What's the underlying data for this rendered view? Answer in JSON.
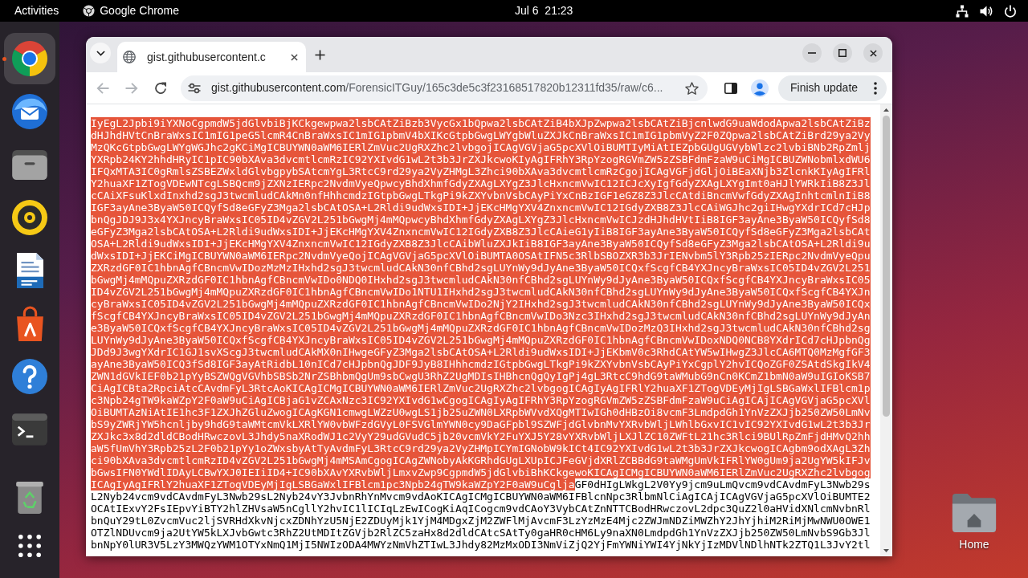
{
  "top_bar": {
    "activities": "Activities",
    "app_menu": "Google Chrome",
    "clock": "Jul 6  21:23"
  },
  "dock": {
    "items": [
      {
        "kind": "browser",
        "running": true,
        "selected": true
      },
      {
        "kind": "mail",
        "running": false,
        "selected": false
      },
      {
        "kind": "files",
        "running": false,
        "selected": false
      },
      {
        "kind": "music",
        "running": false,
        "selected": false
      },
      {
        "kind": "writer",
        "running": false,
        "selected": false
      },
      {
        "kind": "store",
        "running": false,
        "selected": false
      },
      {
        "kind": "help",
        "running": false,
        "selected": false
      },
      {
        "kind": "terminal",
        "running": false,
        "selected": false
      },
      {
        "kind": "trash",
        "running": false,
        "selected": false
      },
      {
        "kind": "apps",
        "running": false,
        "selected": false
      }
    ]
  },
  "desktop": {
    "icons": [
      {
        "label": "Home"
      }
    ]
  },
  "browser": {
    "tabs": [
      {
        "title": "gist.githubusercontent.c",
        "selected": true
      }
    ],
    "back": {
      "disabled": true
    },
    "forward": {
      "disabled": true
    },
    "address_bar": {
      "host": "gist.githubusercontent.com",
      "path": "/ForensicITGuy/165c3de5c3f23168517820b12311fd35/raw/c6..."
    },
    "update_button": "Finish update",
    "page": {
      "lines": [
        {
          "segments": [
            {
              "text": "IyEgL2Jpbi9iYXNoCgpmdW5jdGlvbiBjKCkgewpwa2lsbCAtZiBzb3VycGx1bQpwa2lsbCAtZiB4bXJpZwpwa2lsbCAtZiBjcnlwdG9uaWdodApwa2lsbCAtZiBz",
              "selected": true
            }
          ]
        },
        {
          "segments": [
            {
              "text": "dHJhdHVtCnBraWxsIC1mIG1peG5lcmR4CnBraWxsIC1mIG1pbmV4bXIKcGtpbGwgLWYgbWluZXJkCnBraWxsIC1mIG1pbmVyZ2F0ZQpwa2lsbCAtZiBrd29ya2Vy",
              "selected": true
            }
          ]
        },
        {
          "segments": [
            {
              "text": "MzQKcGtpbGwgLWYgWGJhc2gKCiMgICBUYWN0aWM6IERlZmVuc2UgRXZhc2lvbgojICAgVGVjaG5pcXVlOiBUMTIyMiAtIEZpbGUgUGVybWlzc2lvbiBNb2RpZmlj",
              "selected": true
            }
          ]
        },
        {
          "segments": [
            {
              "text": "YXRpb24KY2hhdHRyIC1pIC90bXAva3dvcmtlcmRzIC92YXIvdG1wL2t3b3JrZXJkcwoKIyAgIFRhY3RpYzogRGVmZW5zZSBFdmFzaW9uCiMgICBUZWNobmlxdWU6",
              "selected": true
            }
          ]
        },
        {
          "segments": [
            {
              "text": "IFQxMTA3IC0gRmlsZSBEZWxldGlvbgpybSAtcmYgL3RtcC9rd29ya2VyZHMgL3Zhci90bXAva3dvcmtlcmRzCgojICAgVGFjdGljOiBEaXNjb3ZlcnkKIyAgIFRl",
              "selected": true
            }
          ]
        },
        {
          "segments": [
            {
              "text": "Y2huaXF1ZTogVDEwNTcgLSBQcm9jZXNzIERpc2NvdmVyeQpwcyBhdXhmfGdyZXAgLXYgZ3JlcHxncmVwIC12ICJcXyIgfGdyZXAgLXYgImt0aHJlYWRkIiB8Z3Jl",
              "selected": true
            }
          ]
        },
        {
          "segments": [
            {
              "text": "cCAiXFsuKlxdInxhd2sgJ3twcmludCAkMn0nfHhhcmdzIGtpbGwgLTkgPi9kZXYvbnVsbCAyPiYxCnBzIGF1eGZ8Z3JlcCAtdiBncmVwfGdyZXAgInhtcmlnIiB8",
              "selected": true
            }
          ]
        },
        {
          "segments": [
            {
              "text": "IGF3ayAne3ByaW50ICQyfSd8eGFyZ3Mga2lsbCAtOSA+L2Rldi9udWxsIDI+JjEKcHMgYXV4ZnxncmVwIC12IGdyZXB8Z3JlcCAiWGJhc2giIHwgYXdrICd7cHJp",
              "selected": true
            }
          ]
        },
        {
          "segments": [
            {
              "text": "bnQgJDJ9J3x4YXJncyBraWxsIC05ID4vZGV2L251bGwgMj4mMQpwcyBhdXhmfGdyZXAgLXYgZ3JlcHxncmVwICJzdHJhdHVtIiB8IGF3ayAne3ByaW50ICQyfSd8",
              "selected": true
            }
          ]
        },
        {
          "segments": [
            {
              "text": "eGFyZ3Mga2lsbCAtOSA+L2Rldi9udWxsIDI+JjEKcHMgYXV4ZnxncmVwIC12IGdyZXB8Z3JlcCAieG1yIiB8IGF3ayAne3ByaW50ICQyfSd8eGFyZ3Mga2lsbCAt",
              "selected": true
            }
          ]
        },
        {
          "segments": [
            {
              "text": "OSA+L2Rldi9udWxsIDI+JjEKcHMgYXV4ZnxncmVwIC12IGdyZXB8Z3JlcCAibWluZXJkIiB8IGF3ayAne3ByaW50ICQyfSd8eGFyZ3Mga2lsbCAtOSA+L2Rldi9u",
              "selected": true
            }
          ]
        },
        {
          "segments": [
            {
              "text": "dWxsIDI+JjEKCiMgICBUYWN0aWM6IERpc2NvdmVyeQojICAgVGVjaG5pcXVlOiBUMTA0OSAtIFN5c3RlbSBOZXR3b3JrIENvbm5lY3Rpb25zIERpc2NvdmVyeQpu",
              "selected": true
            }
          ]
        },
        {
          "segments": [
            {
              "text": "ZXRzdGF0IC1hbnAgfCBncmVwIDozMzMzIHxhd2sgJ3twcmludCAkN30nfCBhd2sgLUYnWy9dJyAne3ByaW50ICQxfScgfCB4YXJncyBraWxsIC05ID4vZGV2L251",
              "selected": true
            }
          ]
        },
        {
          "segments": [
            {
              "text": "bGwgMj4mMQpuZXRzdGF0IC1hbnAgfCBncmVwIDo0NDQ0IHxhd2sgJ3twcmludCAkN30nfCBhd2sgLUYnWy9dJyAne3ByaW50ICQxfScgfCB4YXJncyBraWxsIC05",
              "selected": true
            }
          ]
        },
        {
          "segments": [
            {
              "text": "ID4vZGV2L251bGwgMj4mMQpuZXRzdGF0IC1hbnAgfCBncmVwIDo1NTU1IHxhd2sgJ3twcmludCAkN30nfCBhd2sgLUYnWy9dJyAne3ByaW50ICQxfScgfCB4YXJn",
              "selected": true
            }
          ]
        },
        {
          "segments": [
            {
              "text": "cyBraWxsIC05ID4vZGV2L251bGwgMj4mMQpuZXRzdGF0IC1hbnAgfCBncmVwIDo2NjY2IHxhd2sgJ3twcmludCAkN30nfCBhd2sgLUYnWy9dJyAne3ByaW50ICQx",
              "selected": true
            }
          ]
        },
        {
          "segments": [
            {
              "text": "fScgfCB4YXJncyBraWxsIC05ID4vZGV2L251bGwgMj4mMQpuZXRzdGF0IC1hbnAgfCBncmVwIDo3Nzc3IHxhd2sgJ3twcmludCAkN30nfCBhd2sgLUYnWy9dJyAn",
              "selected": true
            }
          ]
        },
        {
          "segments": [
            {
              "text": "e3ByaW50ICQxfScgfCB4YXJncyBraWxsIC05ID4vZGV2L251bGwgMj4mMQpuZXRzdGF0IC1hbnAgfCBncmVwIDozMzQ3IHxhd2sgJ3twcmludCAkN30nfCBhd2sg",
              "selected": true
            }
          ]
        },
        {
          "segments": [
            {
              "text": "LUYnWy9dJyAne3ByaW50ICQxfScgfCB4YXJncyBraWxsIC05ID4vZGV2L251bGwgMj4mMQpuZXRzdGF0IC1hbnAgfCBncmVwIDoxNDQ0NCB8YXdrICd7cHJpbnQg",
              "selected": true
            }
          ]
        },
        {
          "segments": [
            {
              "text": "JDd9J3wgYXdrIC1GJ1svXScgJ3twcmludCAkMX0nIHwgeGFyZ3Mga2lsbCAtOSA+L2Rldi9udWxsIDI+JjEKbmV0c3RhdCAtYW5wIHwgZ3JlcCA6MTQ0MzMgfGF3",
              "selected": true
            }
          ]
        },
        {
          "segments": [
            {
              "text": "ayAne3ByaW50ICQ3fSd8IGF3ayAtRidbL10nICd7cHJpbnQgJDF9JyB8IHhhcmdzIGtpbGwgLTkgPi9kZXYvbnVsbCAyPiYxCgplY2hvICQoZGF0ZSAtdSkgIkV4",
              "selected": true
            }
          ]
        },
        {
          "segments": [
            {
              "text": "ZWN1dGVkIEF0b21pYyBSZWQgVGVhbSBSb2NrZSBhbmQgUm9sbCwgU3RhZ2UgMDIsIHBhcnQgQyIgPj4gL3RtcC9hdG9taWMubG9nCn0KCmZ1bmN0aW9uIGIoKSB7",
              "selected": true
            }
          ]
        },
        {
          "segments": [
            {
              "text": "CiAgICBta2RpciAtcCAvdmFyL3RtcAoKICAgICMgICBUYWN0aWM6IERlZmVuc2UgRXZhc2lvbgogICAgIyAgIFRlY2huaXF1ZTogVDEyMjIgLSBGaWxlIFBlcm1p",
              "selected": true
            }
          ]
        },
        {
          "segments": [
            {
              "text": "c3Npb24gTW9kaWZpY2F0aW9uCiAgICBjaG1vZCAxNzc3IC92YXIvdG1wCgogICAgIyAgIFRhY3RpYzogRGVmZW5zZSBFdmFzaW9uCiAgICAjICAgVGVjaG5pcXVl",
              "selected": true
            }
          ]
        },
        {
          "segments": [
            {
              "text": "OiBUMTAzNiAtIE1hc3F1ZXJhZGluZwogICAgKGN1cmwgLWZzU0wgLS1jb25uZWN0LXRpbWVvdXQgMTIwIGh0dHBzOi8vcmF3LmdpdGh1YnVzZXJjb250ZW50LmNv",
              "selected": true
            }
          ]
        },
        {
          "segments": [
            {
              "text": "bS9yZWRjYW5hcnljby9hdG9taWMtcmVkLXRlYW0vbWFzdGVyL0FSVGlmYWN0cy9DaGFpbl9SZWFjdGlvbnMvYXRvbWljLWhlbGxvIC1vIC92YXIvdG1wL2t3b3Jr",
              "selected": true
            }
          ]
        },
        {
          "segments": [
            {
              "text": "ZXJkc3x8d2dldCBodHRwczovL3Jhdy5naXRodWJ1c2VyY29udGVudC5jb20vcmVkY2FuYXJ5Y28vYXRvbWljLXJlZC10ZWFtL21hc3Rlci9BUlRpZmFjdHMvQ2hh",
              "selected": true
            }
          ]
        },
        {
          "segments": [
            {
              "text": "aW5fUmVhY3Rpb25zL2F0b21pYy1oZWxsbyAtTyAvdmFyL3RtcC9rd29ya2VyZHMpICYmIGNobW9kICt4IC92YXIvdG1wL2t3b3JrZXJkcwogICAgbm9odXAgL3Zh",
              "selected": true
            }
          ]
        },
        {
          "segments": [
            {
              "text": "ci90bXAva3dvcmtlcmRzID4vZGV2L251bGwgMj4mMSAmCgogICAgZWNobyAkKGRhdGUgLXUpICJFeGVjdXRlZCBBdG9taWMgUmVkIFRlYW0gUm9ja2UgYW5kIFJv",
              "selected": true
            }
          ]
        },
        {
          "segments": [
            {
              "text": "bGwsIFN0YWdlIDAyLCBwYXJ0IEIiID4+IC90bXAvYXRvbWljLmxvZwp9CgpmdW5jdGlvbiBhKCkgewoKICAgICMgICBUYWN0aWM6IERlZmVuc2UgRXZhc2lvbgog",
              "selected": true
            }
          ]
        },
        {
          "segments": [
            {
              "text": "ICAgIyAgIFRlY2huaXF1ZTogVDEyMjIgLSBGaWxlIFBlcm1pc3Npb24gTW9kaWZpY2F0aW9uCglja",
              "selected": true
            },
            {
              "text": "GF0dHIgLWkgL2V0Yy9jcm9uLmQvcm9vdCAvdmFyL3Nwb29s",
              "selected": false
            }
          ]
        },
        {
          "segments": [
            {
              "text": "L2Nyb24vcm9vdCAvdmFyL3Nwb29sL2Nyb24vY3JvbnRhYnMvcm9vdAoKICAgICMgICBUYWN0aWM6IFBlcnNpc3RlbmNlCiAgICAjICAgVGVjaG5pcXVlOiBUMTE2",
              "selected": false
            }
          ]
        },
        {
          "segments": [
            {
              "text": "OCAtIExvY2FsIEpvYiBTY2hlZHVsaW5nCgllY2hvIC1lICIqLzEwICogKiAqICogcm9vdCAoY3VybCAtZnNTTCBodHRwczovL2dpc3QuZ2l0aHVidXNlcmNvbnRl",
              "selected": false
            }
          ]
        },
        {
          "segments": [
            {
              "text": "bnQuY29tL0ZvcmVuc2ljSVRHdXkvNjcxZDNhYzU5NjE2ZDUyMjk1YjM4MDgxZjM2ZWFlMjAvcmF3LzYzMzE4Mjc2ZWJmNDZiMWZhY2JhYjhiM2RiMjMwNWU0OWE1",
              "selected": false
            }
          ]
        },
        {
          "segments": [
            {
              "text": "OTZlNDUvcm9ja2UtYW5kLXJvbGwtc3RhZ2UtMDItZGVjb2RlZC5zaHx8d2dldCAtcSAtTy0gaHR0cHM6Ly9naXN0LmdpdGh1YnVzZXJjb250ZW50LmNvbS9Gb3Jl",
              "selected": false
            }
          ]
        },
        {
          "segments": [
            {
              "text": "bnNpY0lUR3V5LzY3MWQzYWM1OTYxNmQ1MjI5NWIzODA4MWYzNmVhZTIwL3Jhdy82MzMxODI3NmViZjQ2YjFmYWNiYWI4YjNkYjIzMDVlNDlhNTk2ZTQ1L3JvY2tl",
              "selected": false
            }
          ]
        }
      ]
    }
  }
}
